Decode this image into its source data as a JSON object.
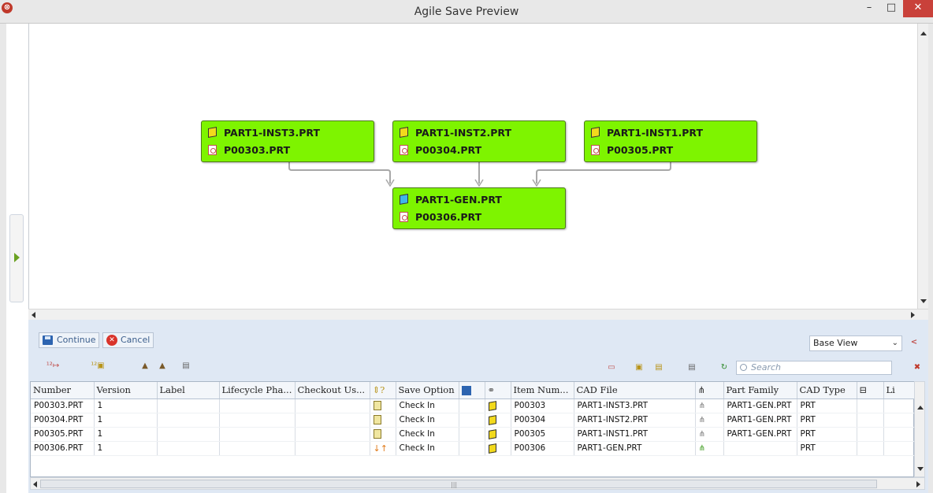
{
  "window": {
    "title": "Agile Save Preview",
    "minimize": "–",
    "maximize": "□",
    "close": "✕"
  },
  "diagram": {
    "nodes": [
      {
        "part": "PART1-INST3.PRT",
        "doc": "P00303.PRT"
      },
      {
        "part": "PART1-INST2.PRT",
        "doc": "P00304.PRT"
      },
      {
        "part": "PART1-INST1.PRT",
        "doc": "P00305.PRT"
      },
      {
        "part": "PART1-GEN.PRT",
        "doc": "P00306.PRT"
      }
    ]
  },
  "actions": {
    "continue_label": "Continue",
    "cancel_label": "Cancel"
  },
  "view_select": {
    "value": "Base View"
  },
  "search": {
    "placeholder": "Search"
  },
  "table": {
    "headers": [
      "Number",
      "Version",
      "Label",
      "Lifecycle Pha...",
      "Checkout Us...",
      "",
      "Save Option",
      "",
      "",
      "Item Num...",
      "CAD File",
      "",
      "Part Family",
      "CAD Type",
      "",
      "Li"
    ],
    "rows": [
      {
        "number": "P00303.PRT",
        "version": "1",
        "save_option": "Check In",
        "item_num": "P00303",
        "cad_file": "PART1-INST3.PRT",
        "part_family": "PART1-GEN.PRT",
        "cad_type": "PRT"
      },
      {
        "number": "P00304.PRT",
        "version": "1",
        "save_option": "Check In",
        "item_num": "P00304",
        "cad_file": "PART1-INST2.PRT",
        "part_family": "PART1-GEN.PRT",
        "cad_type": "PRT"
      },
      {
        "number": "P00305.PRT",
        "version": "1",
        "save_option": "Check In",
        "item_num": "P00305",
        "cad_file": "PART1-INST1.PRT",
        "part_family": "PART1-GEN.PRT",
        "cad_type": "PRT"
      },
      {
        "number": "P00306.PRT",
        "version": "1",
        "save_option": "Check In",
        "item_num": "P00306",
        "cad_file": "PART1-GEN.PRT",
        "part_family": "",
        "cad_type": "PRT"
      }
    ]
  },
  "colors": {
    "node_fill": "#7ef400",
    "panel_bg": "#dfe8f4",
    "close_red": "#c9413a"
  }
}
